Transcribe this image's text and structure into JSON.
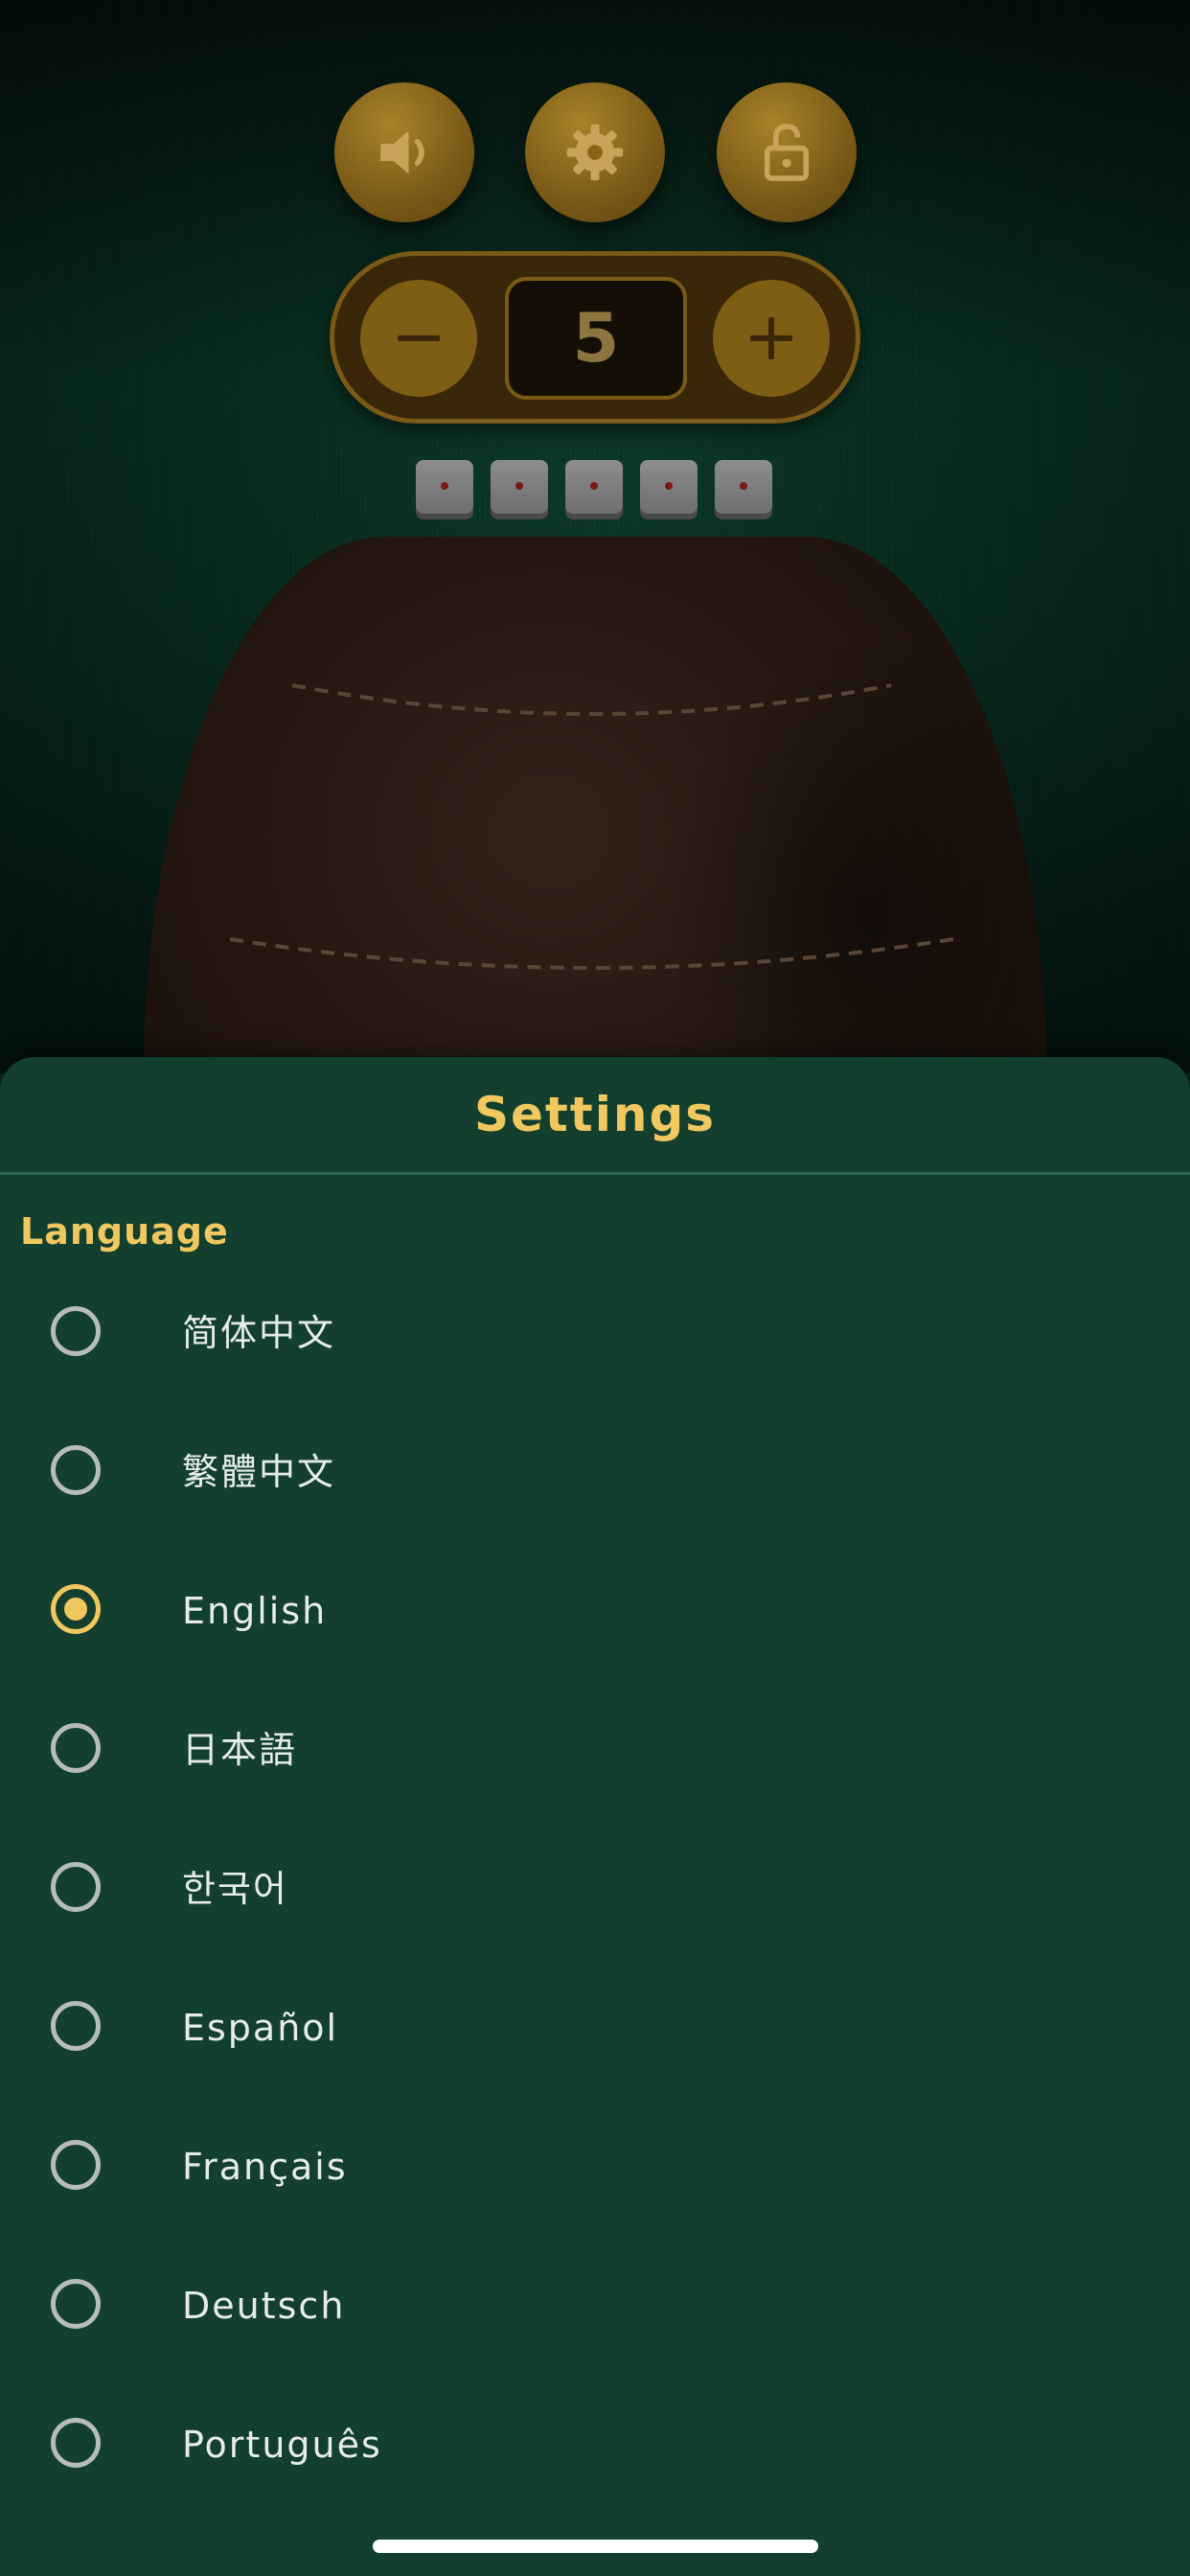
{
  "toolbar": {
    "sound_icon": "speaker-icon",
    "settings_icon": "gear-icon",
    "lock_icon": "unlock-icon"
  },
  "stepper": {
    "value": "5"
  },
  "dice": [
    1,
    1,
    1,
    1,
    1
  ],
  "settings": {
    "title": "Settings",
    "section_language": "Language",
    "selected": "English",
    "languages": [
      {
        "label": "简体中文",
        "selected": false
      },
      {
        "label": "繁體中文",
        "selected": false
      },
      {
        "label": "English",
        "selected": true
      },
      {
        "label": "日本語",
        "selected": false
      },
      {
        "label": "한국어",
        "selected": false
      },
      {
        "label": "Español",
        "selected": false
      },
      {
        "label": "Français",
        "selected": false
      },
      {
        "label": "Deutsch",
        "selected": false
      },
      {
        "label": "Português",
        "selected": false
      }
    ]
  },
  "colors": {
    "accent": "#f1c85f",
    "sheet_bg": "#123f2e",
    "button_gold": "#7e5d14"
  }
}
